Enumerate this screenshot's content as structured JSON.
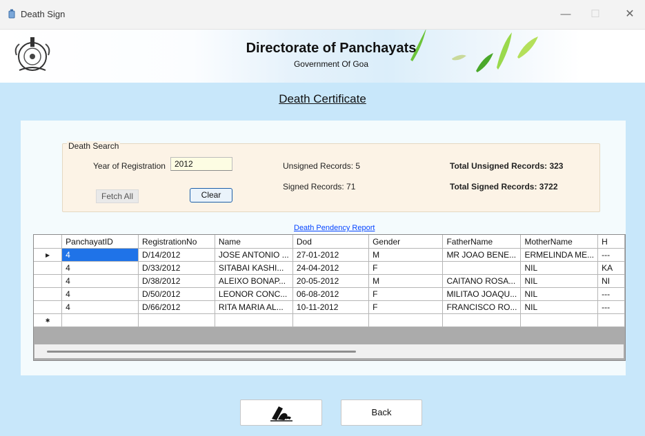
{
  "window": {
    "title": "Death Sign",
    "minimize": "—",
    "maximize": "☐",
    "close": "✕"
  },
  "header": {
    "org_title": "Directorate of Panchayats",
    "org_subtitle": "Government Of Goa"
  },
  "page_heading": "Death Certificate",
  "search": {
    "legend": "Death Search",
    "year_label": "Year of Registration",
    "year_value": "2012",
    "fetch_all_label": "Fetch All",
    "clear_label": "Clear",
    "unsigned_records": "Unsigned Records: 5",
    "signed_records": "Signed Records: 71",
    "total_unsigned": "Total Unsigned Records: 323",
    "total_signed": "Total Signed Records: 3722"
  },
  "report_link": "Death Pendency Report",
  "grid": {
    "columns": [
      "PanchayatID",
      "RegistrationNo",
      "Name",
      "Dod",
      "Gender",
      "FatherName",
      "MotherName",
      "H"
    ],
    "rows": [
      [
        "4",
        "D/14/2012",
        "JOSE ANTONIO ...",
        "27-01-2012",
        "M",
        "MR JOAO BENE...",
        "ERMELINDA ME...",
        "---"
      ],
      [
        "4",
        "D/33/2012",
        "SITABAI KASHI...",
        "24-04-2012",
        "F",
        "",
        "NIL",
        "KA"
      ],
      [
        "4",
        "D/38/2012",
        "ALEIXO BONAP...",
        "20-05-2012",
        "M",
        "CAITANO ROSA...",
        "NIL",
        "NI"
      ],
      [
        "4",
        "D/50/2012",
        "LEONOR CONC...",
        "06-08-2012",
        "F",
        "MILITAO JOAQU...",
        "NIL",
        "---"
      ],
      [
        "4",
        "D/66/2012",
        "RITA MARIA AL...",
        "10-11-2012",
        "F",
        "FRANCISCO RO...",
        "NIL",
        "---"
      ]
    ],
    "current_row_marker": "▶",
    "new_row_marker": "✱"
  },
  "footer": {
    "back_label": "Back"
  },
  "colors": {
    "main_bg": "#c8e7fa",
    "selection": "#1f73e8",
    "link": "#0645ff"
  }
}
